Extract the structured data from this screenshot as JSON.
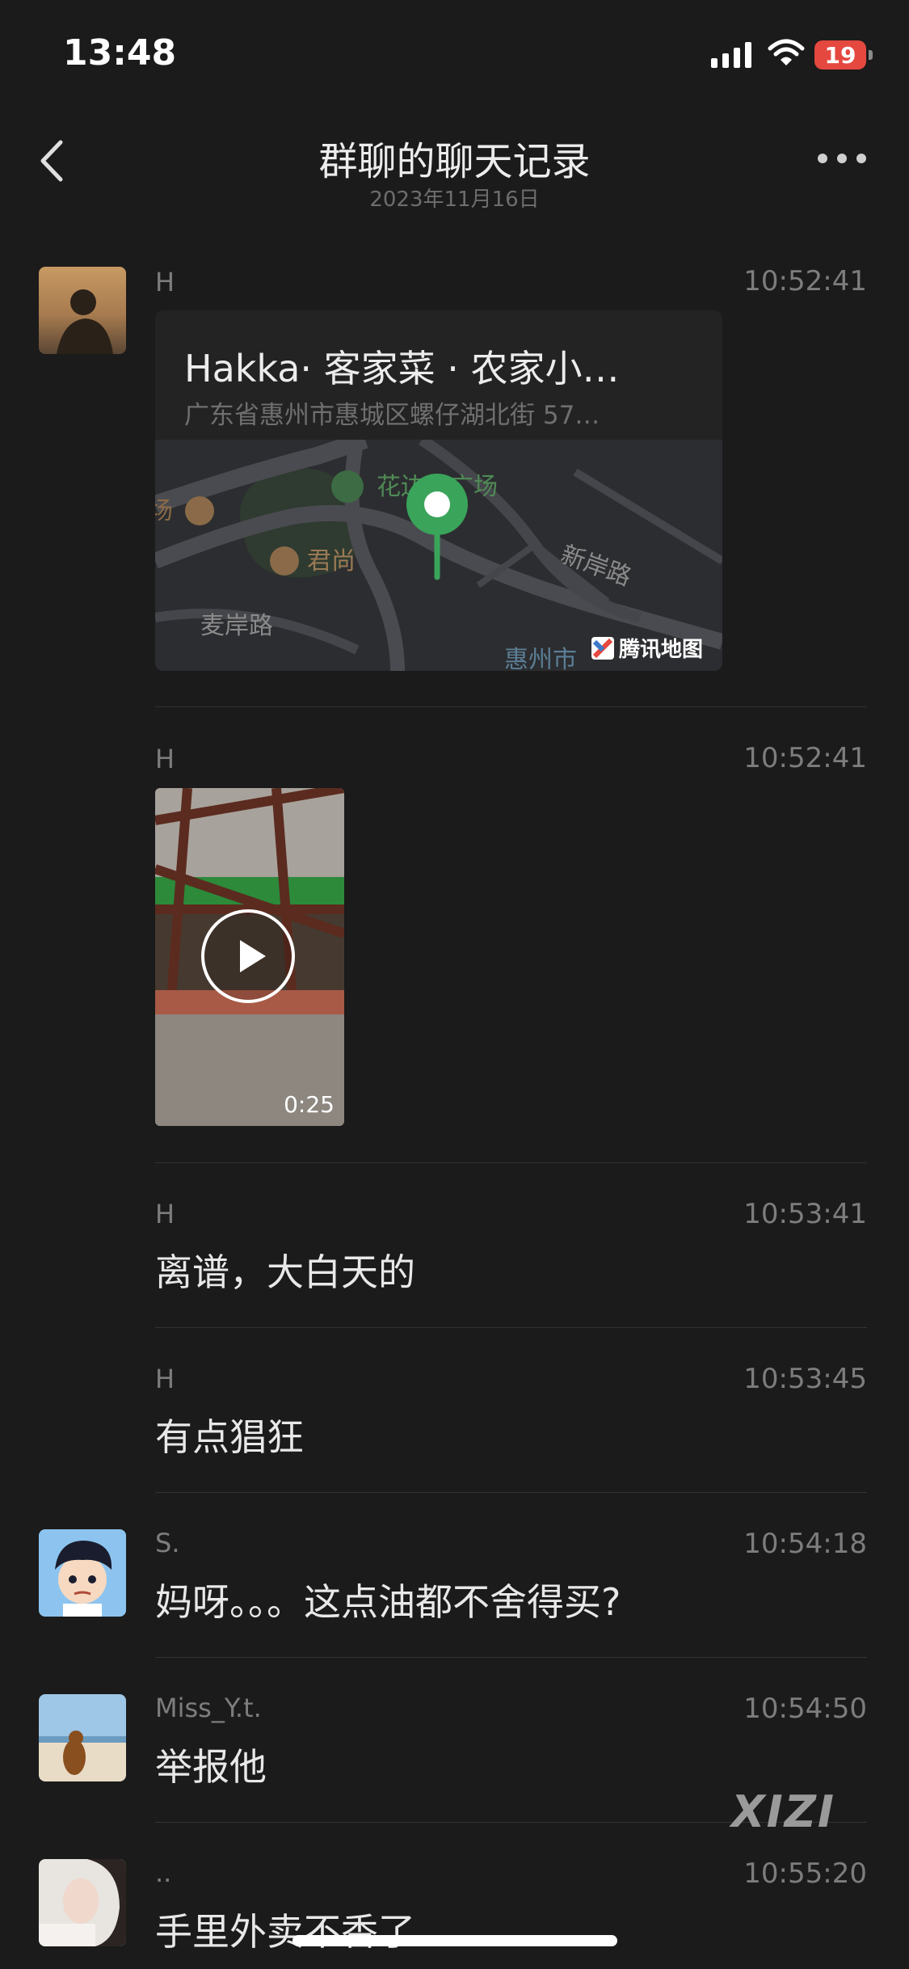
{
  "status_bar": {
    "time": "13:48",
    "battery": "19"
  },
  "nav": {
    "title": "群聊的聊天记录",
    "date": "2023年11月16日"
  },
  "messages": [
    {
      "sender": "H",
      "time": "10:52:41",
      "type": "location",
      "location": {
        "name": "Hakka· 客家菜 · 农家小…",
        "address": "广东省惠州市惠城区螺仔湖北街 57…",
        "map_labels": [
          "花边岭广场",
          "君尚",
          "新岸路",
          "麦岸路",
          "惠州市",
          "腾讯地图"
        ]
      }
    },
    {
      "sender": "H",
      "time": "10:52:41",
      "type": "video",
      "duration": "0:25"
    },
    {
      "sender": "H",
      "time": "10:53:41",
      "type": "text",
      "text": "离谱，大白天的"
    },
    {
      "sender": "H",
      "time": "10:53:45",
      "type": "text",
      "text": "有点猖狂"
    },
    {
      "sender": "S.",
      "time": "10:54:18",
      "type": "text",
      "text": "妈呀。。。这点油都不舍得买?"
    },
    {
      "sender": "Miss_Y.t.",
      "time": "10:54:50",
      "type": "text",
      "text": "举报他"
    },
    {
      "sender": "..",
      "time": "10:55:20",
      "type": "text",
      "text": "手里外卖不香了"
    }
  ],
  "watermark": "XIZI"
}
